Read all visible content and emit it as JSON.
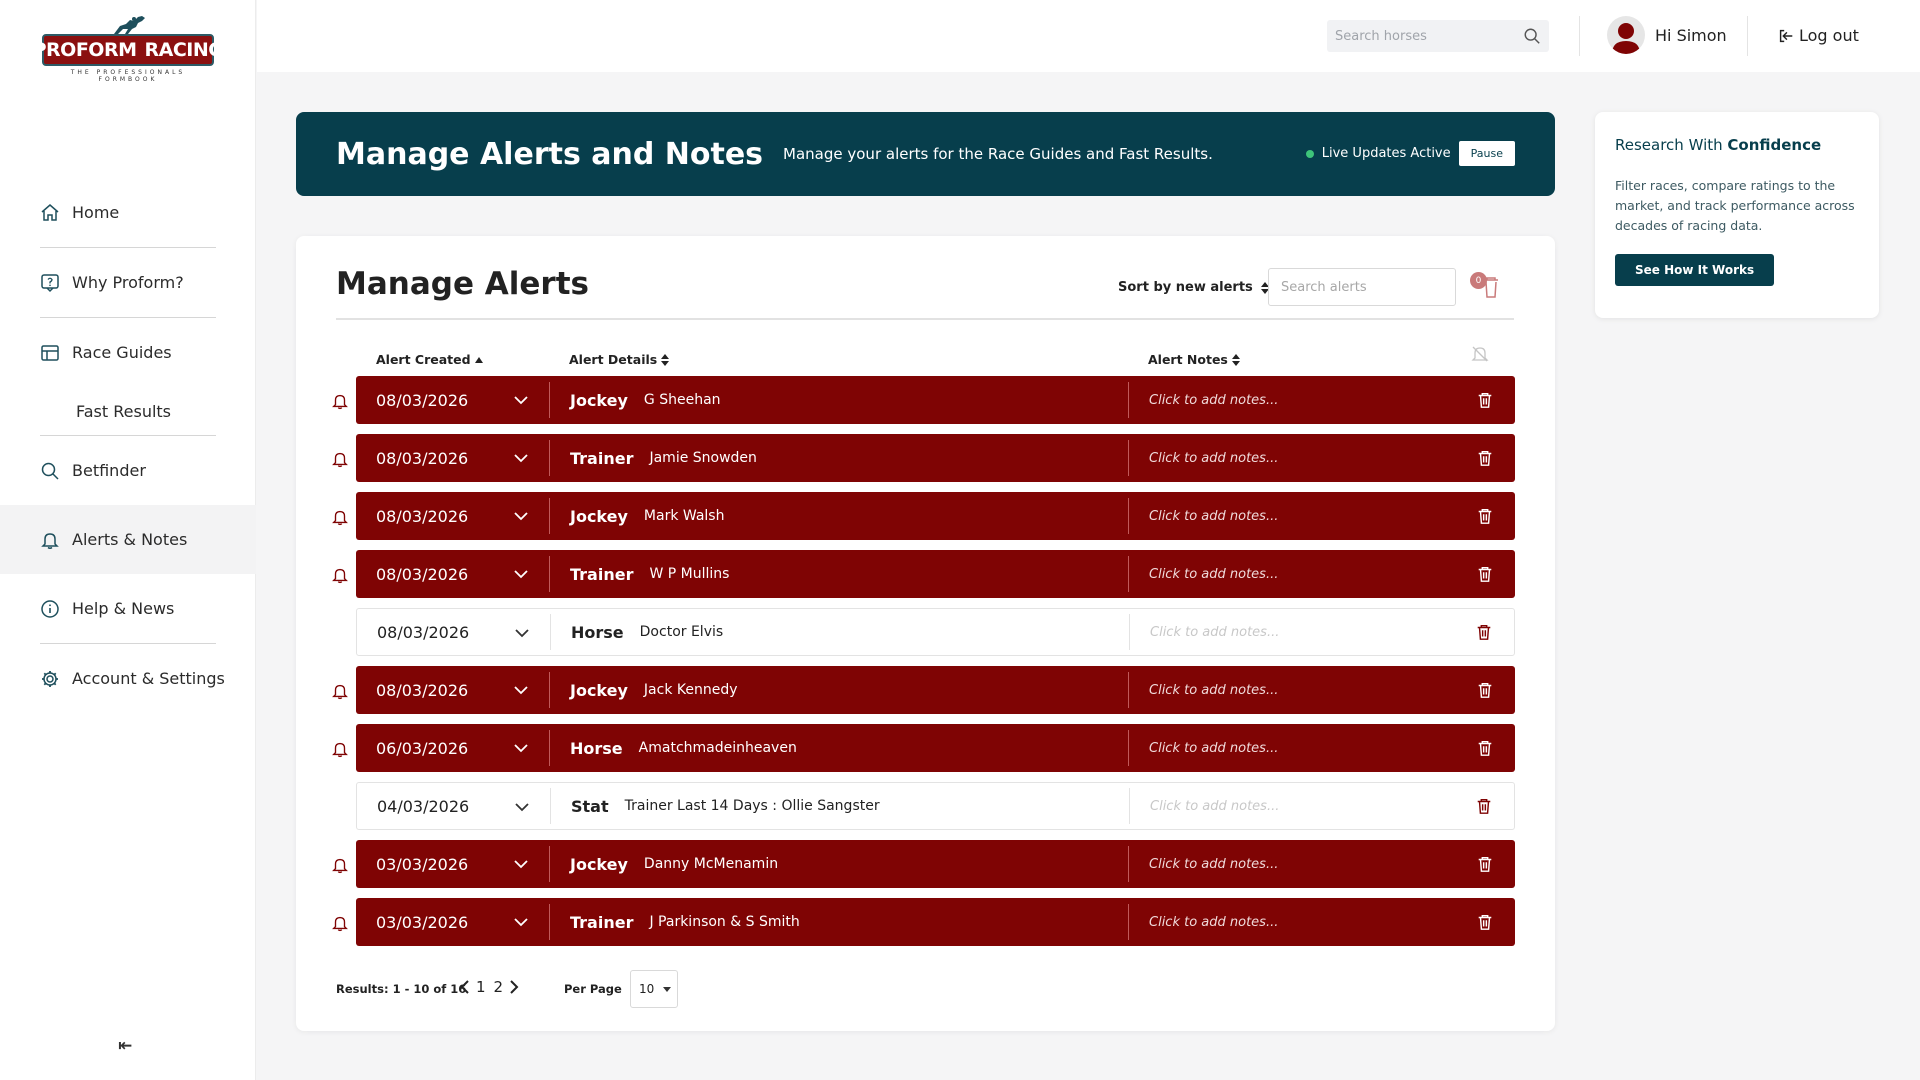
{
  "logo": {
    "word1": "PROFORM",
    "word2": "RACING",
    "tagline": "THE PROFESSIONALS FORMBOOK"
  },
  "nav": {
    "home": "Home",
    "why": "Why Proform?",
    "race_guides": "Race Guides",
    "fast_results": "Fast Results",
    "betfinder": "Betfinder",
    "alerts": "Alerts & Notes",
    "help": "Help & News",
    "account": "Account & Settings",
    "collapse": "⇤"
  },
  "topbar": {
    "search_placeholder": "Search horses",
    "user_greeting": "Hi Simon",
    "logout": "Log out"
  },
  "banner": {
    "title": "Manage Alerts and Notes",
    "subtitle": "Manage your alerts for the Race Guides and Fast Results.",
    "live_text": "Live Updates Active",
    "pause": "Pause"
  },
  "side_card": {
    "title_light": "Research With ",
    "title_bold": "Confidence",
    "body": "Filter races, compare ratings to the market, and track performance across decades of racing data.",
    "button": "See How It Works"
  },
  "alerts": {
    "title_light": "Manage ",
    "title_bold": "Alerts",
    "sort_label": "Sort by new alerts",
    "search_placeholder": "Search alerts",
    "bin_count": "0",
    "columns": {
      "created": "Alert Created",
      "details": "Alert Details",
      "notes": "Alert Notes"
    },
    "notes_placeholder": "Click to add notes...",
    "rows": [
      {
        "date": "08/03/2026",
        "type": "Jockey",
        "value": "G Sheehan",
        "active": true
      },
      {
        "date": "08/03/2026",
        "type": "Trainer",
        "value": "Jamie Snowden",
        "active": true
      },
      {
        "date": "08/03/2026",
        "type": "Jockey",
        "value": "Mark Walsh",
        "active": true
      },
      {
        "date": "08/03/2026",
        "type": "Trainer",
        "value": "W P Mullins",
        "active": true
      },
      {
        "date": "08/03/2026",
        "type": "Horse",
        "value": "Doctor Elvis",
        "active": false
      },
      {
        "date": "08/03/2026",
        "type": "Jockey",
        "value": "Jack Kennedy",
        "active": true
      },
      {
        "date": "06/03/2026",
        "type": "Horse",
        "value": "Amatchmadeinheaven",
        "active": true
      },
      {
        "date": "04/03/2026",
        "type": "Stat",
        "value": "Trainer Last 14 Days : Ollie Sangster",
        "active": false
      },
      {
        "date": "03/03/2026",
        "type": "Jockey",
        "value": "Danny McMenamin",
        "active": true
      },
      {
        "date": "03/03/2026",
        "type": "Trainer",
        "value": "J Parkinson & S Smith",
        "active": true
      }
    ],
    "results": "Results: 1 - 10 of 16",
    "pages": [
      "1",
      "2"
    ],
    "per_page_label": "Per Page",
    "per_page": "10"
  },
  "colors": {
    "brand_dark": "#073e4c",
    "alert_red": "#7f0404",
    "logo_red": "#8b1010"
  }
}
